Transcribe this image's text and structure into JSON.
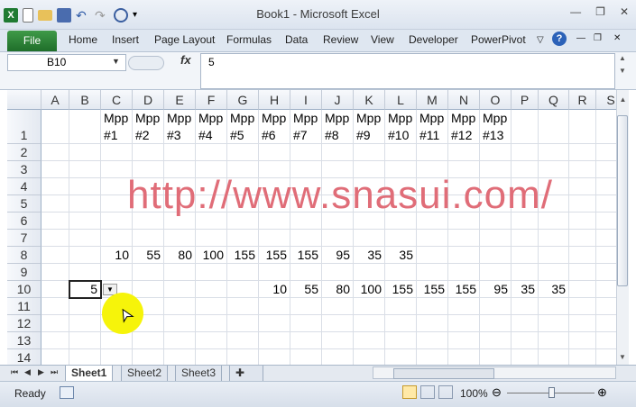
{
  "app": {
    "title": "Book1  -  Microsoft Excel"
  },
  "window_controls": {
    "minimize": "—",
    "restore": "❐",
    "close": "✕"
  },
  "ribbon_tabs": [
    "File",
    "Home",
    "Insert",
    "Page Layout",
    "Formulas",
    "Data",
    "Review",
    "View",
    "Developer",
    "PowerPivot"
  ],
  "formula_bar": {
    "name_box": "B10",
    "fx_label": "fx",
    "content": "5"
  },
  "columns": [
    "A",
    "B",
    "C",
    "D",
    "E",
    "F",
    "G",
    "H",
    "I",
    "J",
    "K",
    "L",
    "M",
    "N",
    "O",
    "P",
    "Q",
    "R",
    "S"
  ],
  "rows": [
    "1",
    "2",
    "3",
    "4",
    "5",
    "6",
    "7",
    "8",
    "9",
    "10",
    "11",
    "12",
    "13",
    "14"
  ],
  "header_row": {
    "line1": "Mpp",
    "labels": [
      "#1",
      "#2",
      "#3",
      "#4",
      "#5",
      "#6",
      "#7",
      "#8",
      "#9",
      "#10",
      "#11",
      "#12",
      "#13"
    ]
  },
  "row8_values": [
    "10",
    "55",
    "80",
    "100",
    "155",
    "155",
    "155",
    "95",
    "35",
    "35"
  ],
  "row10_b": "5",
  "row10_values": [
    "10",
    "55",
    "80",
    "100",
    "155",
    "155",
    "155",
    "95",
    "35",
    "35"
  ],
  "watermark": "http://www.snasui.com/",
  "sheets": [
    "Sheet1",
    "Sheet2",
    "Sheet3"
  ],
  "status": {
    "ready": "Ready",
    "zoom": "100%"
  },
  "colors": {
    "file_tab": "#2a8a36",
    "watermark": "#e06d78",
    "cursor_highlight": "#f6f40a"
  }
}
